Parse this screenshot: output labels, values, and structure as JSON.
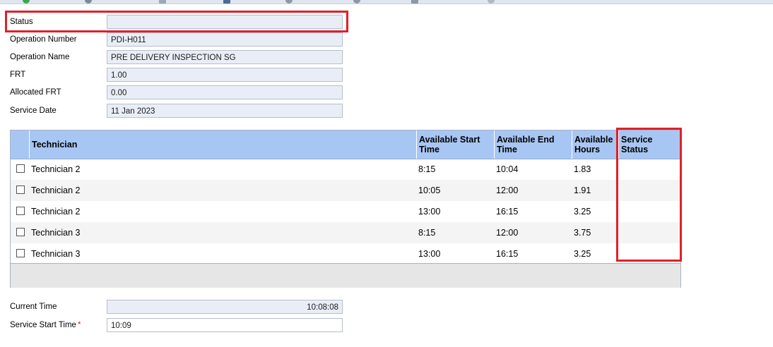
{
  "form": {
    "status": {
      "label": "Status",
      "value": ""
    },
    "operation_number": {
      "label": "Operation Number",
      "value": "PDI-H011"
    },
    "operation_name": {
      "label": "Operation Name",
      "value": "PRE DELIVERY  INSPECTION SG"
    },
    "frt": {
      "label": "FRT",
      "value": "1.00"
    },
    "allocated_frt": {
      "label": "Allocated FRT",
      "value": "0.00"
    },
    "service_date": {
      "label": "Service Date",
      "value": "11 Jan 2023"
    }
  },
  "grid": {
    "headers": {
      "technician": "Technician",
      "start": "Available Start Time",
      "end": "Available End Time",
      "hours": "Available Hours",
      "service_status": "Service Status"
    },
    "rows": [
      {
        "technician": "Technician 2",
        "start": "8:15",
        "end": "10:04",
        "hours": "1.83",
        "service_status": ""
      },
      {
        "technician": "Technician 2",
        "start": "10:05",
        "end": "12:00",
        "hours": "1.91",
        "service_status": ""
      },
      {
        "technician": "Technician 2",
        "start": "13:00",
        "end": "16:15",
        "hours": "3.25",
        "service_status": ""
      },
      {
        "technician": "Technician 3",
        "start": "8:15",
        "end": "12:00",
        "hours": "3.75",
        "service_status": ""
      },
      {
        "technician": "Technician 3",
        "start": "13:00",
        "end": "16:15",
        "hours": "3.25",
        "service_status": ""
      }
    ]
  },
  "footer_form": {
    "current_time": {
      "label": "Current Time",
      "value": "10:08:08"
    },
    "service_start_time": {
      "label": "Service Start Time",
      "required_mark": "*",
      "value": "10:09"
    }
  },
  "colors": {
    "header_bg": "#a8c6f3",
    "field_bg": "#e9eef6",
    "highlight": "#e0202a"
  }
}
